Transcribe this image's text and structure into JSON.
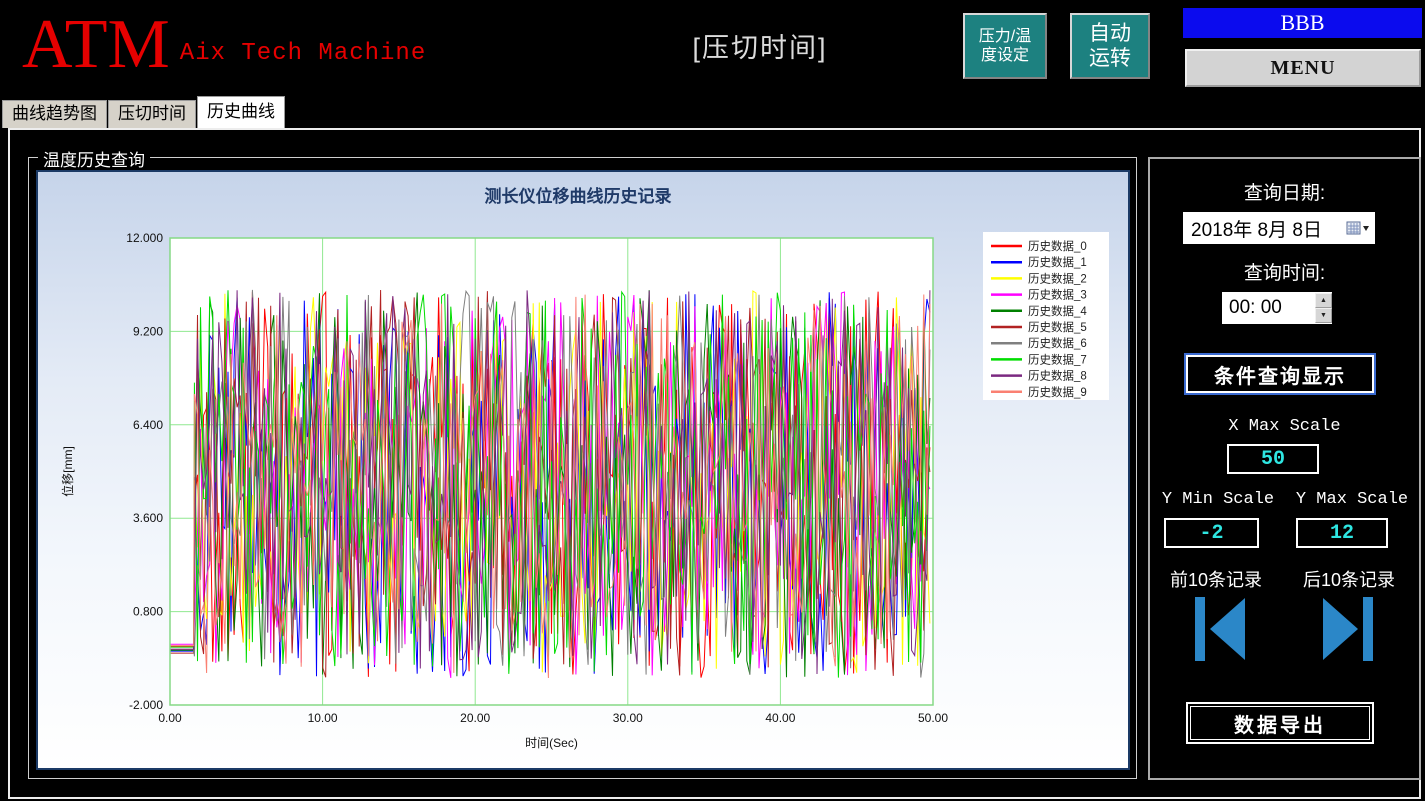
{
  "header": {
    "logo": "ATM",
    "logo_sub": "Aix Tech Machine",
    "title": "[压切时间]",
    "btn_pressure_temp_line1": "压力/温",
    "btn_pressure_temp_line2": "度设定",
    "btn_auto_line1": "自动",
    "btn_auto_line2": "运转",
    "bbb": "BBB",
    "menu": "MENU"
  },
  "tabs": [
    {
      "label": "曲线趋势图",
      "active": false
    },
    {
      "label": "压切时间",
      "active": false
    },
    {
      "label": "历史曲线",
      "active": true
    }
  ],
  "groupbox_label": "温度历史查询",
  "chart_data": {
    "type": "line",
    "title": "测长仪位移曲线历史记录",
    "xlabel": "时间(Sec)",
    "ylabel": "位移[mm]",
    "xlim": [
      0,
      50
    ],
    "ylim": [
      -2,
      12
    ],
    "x_ticks": [
      "0.00",
      "10.00",
      "20.00",
      "30.00",
      "40.00",
      "50.00"
    ],
    "x_tick_values": [
      0,
      10,
      20,
      30,
      40,
      50
    ],
    "y_ticks": [
      "12.000",
      "9.200",
      "6.400",
      "3.600",
      "0.800",
      "-2.000"
    ],
    "y_tick_values": [
      12,
      9.2,
      6.4,
      3.6,
      0.8,
      -2
    ],
    "grid": true,
    "grid_color": "#90e890",
    "plot_bg": "#ffffff",
    "legend_position": "right",
    "series": [
      {
        "name": "历史数据_0",
        "color": "#ff0000"
      },
      {
        "name": "历史数据_1",
        "color": "#0000ff"
      },
      {
        "name": "历史数据_2",
        "color": "#ffff00"
      },
      {
        "name": "历史数据_3",
        "color": "#ff00ff"
      },
      {
        "name": "历史数据_4",
        "color": "#008000"
      },
      {
        "name": "历史数据_5",
        "color": "#b22222"
      },
      {
        "name": "历史数据_6",
        "color": "#808080"
      },
      {
        "name": "历史数据_7",
        "color": "#00dd00"
      },
      {
        "name": "历史数据_8",
        "color": "#7b2981"
      },
      {
        "name": "历史数据_9",
        "color": "#fa8072"
      }
    ],
    "pattern": {
      "description": "each series is flat near -0.3 until x≈1.6 s, then dense random noise",
      "flat_start_y": -0.3,
      "flat_until_x": 1.6,
      "noise_min": -1.2,
      "noise_max": 10.45,
      "sample_step_sec": 0.2
    }
  },
  "side_panel": {
    "query_date_label": "查询日期:",
    "date_value": "2018年 8月 8日",
    "query_time_label": "查询时间:",
    "time_value": "00: 00",
    "query_button": "条件查询显示",
    "x_max_label": "X Max Scale",
    "x_max_value": "50",
    "y_min_label": "Y Min Scale",
    "y_min_value": "-2",
    "y_max_label": "Y Max Scale",
    "y_max_value": "12",
    "prev_label": "前10条记录",
    "next_label": "后10条记录",
    "export_button": "数据导出"
  },
  "icons": {
    "date_picker": "calendar-grid-with-dropdown-arrow",
    "time_spinner": "up-down-arrows",
    "nav_prev": "skip-to-first",
    "nav_next": "skip-to-last"
  },
  "colors": {
    "logo_red": "#e60000",
    "accent_teal": "#1d8180",
    "bbb_blue": "#0b0bee",
    "value_cyan": "#2ee6e2",
    "nav_blue": "#2b87c8",
    "chart_border_navy": "#1b3a66",
    "chart_title_navy": "#1f3a68",
    "grid_green": "#90e890"
  }
}
